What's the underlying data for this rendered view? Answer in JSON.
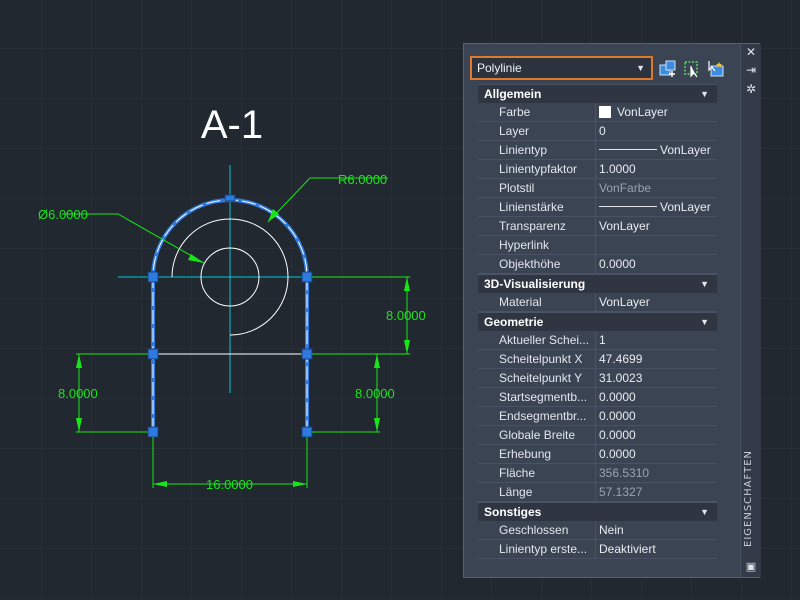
{
  "drawing": {
    "title": "A-1",
    "dim_top": "8.0000",
    "dim_left": "8.0000",
    "dim_right": "8.0000",
    "dim_bottom": "16.0000",
    "dim_radius": "R6.0000",
    "dim_diameter": "Ø6.0000"
  },
  "palette": {
    "selected_type": "Polylinie",
    "side_title": "EIGENSCHAFTEN",
    "sections": [
      {
        "title": "Allgemein",
        "rows": [
          {
            "name": "Farbe",
            "value": "VonLayer",
            "kind": "swatch"
          },
          {
            "name": "Layer",
            "value": "0"
          },
          {
            "name": "Linientyp",
            "value": "VonLayer",
            "kind": "line"
          },
          {
            "name": "Linientypfaktor",
            "value": "1.0000"
          },
          {
            "name": "Plotstil",
            "value": "VonFarbe",
            "ro": true
          },
          {
            "name": "Linienstärke",
            "value": "VonLayer",
            "kind": "line"
          },
          {
            "name": "Transparenz",
            "value": "VonLayer"
          },
          {
            "name": "Hyperlink",
            "value": ""
          },
          {
            "name": "Objekthöhe",
            "value": "0.0000"
          }
        ]
      },
      {
        "title": "3D-Visualisierung",
        "rows": [
          {
            "name": "Material",
            "value": "VonLayer"
          }
        ]
      },
      {
        "title": "Geometrie",
        "rows": [
          {
            "name": "Aktueller Schei...",
            "value": "1"
          },
          {
            "name": "Scheitelpunkt X",
            "value": "47.4699"
          },
          {
            "name": "Scheitelpunkt Y",
            "value": "31.0023"
          },
          {
            "name": "Startsegmentb...",
            "value": "0.0000"
          },
          {
            "name": "Endsegmentbr...",
            "value": "0.0000"
          },
          {
            "name": "Globale Breite",
            "value": "0.0000"
          },
          {
            "name": "Erhebung",
            "value": "0.0000"
          },
          {
            "name": "Fläche",
            "value": "356.5310",
            "ro": true
          },
          {
            "name": "Länge",
            "value": "57.1327",
            "ro": true
          }
        ]
      },
      {
        "title": "Sonstiges",
        "rows": [
          {
            "name": "Geschlossen",
            "value": "Nein"
          },
          {
            "name": "Linientyp erste...",
            "value": "Deaktiviert"
          }
        ]
      }
    ]
  },
  "colors": {
    "background": "#212830",
    "dimension": "#19e619",
    "centerline": "#00c8d8",
    "selection": "#2f7ae0",
    "highlight": "#e0792a"
  }
}
